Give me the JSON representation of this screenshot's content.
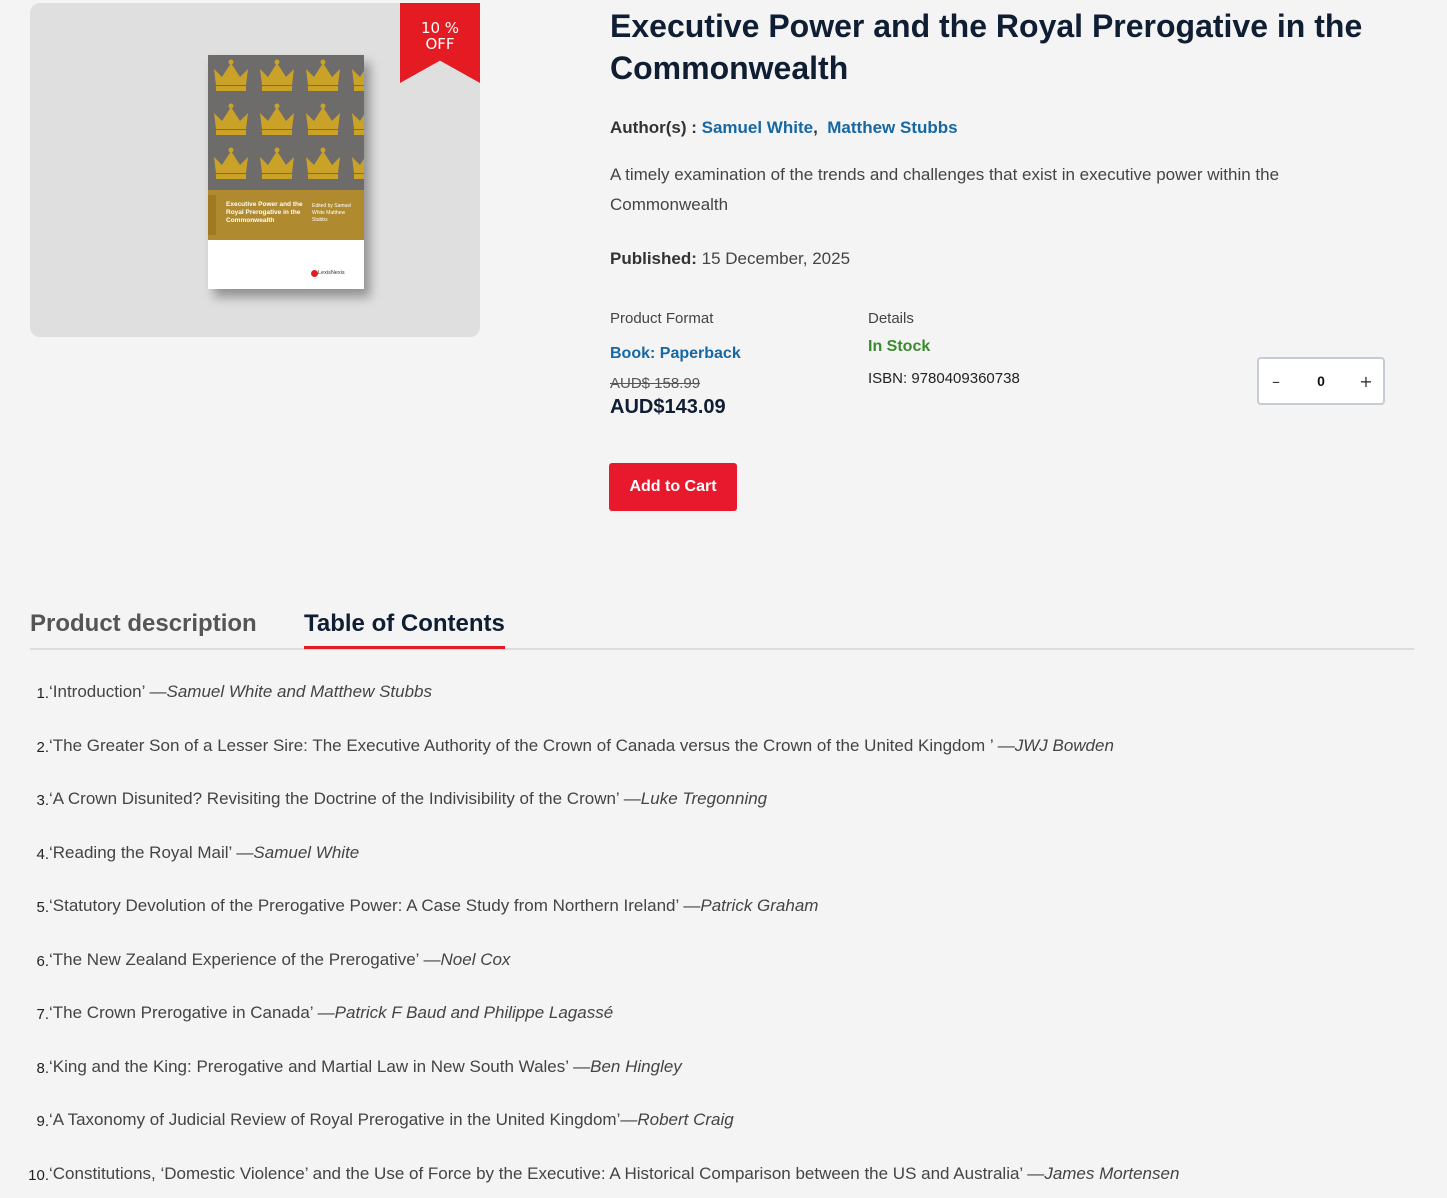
{
  "badge": {
    "line1": "10 %",
    "line2": "OFF"
  },
  "cover": {
    "title": "Executive Power and the Royal Prerogative in the Commonwealth",
    "editors": "Edited by Samuel White Matthew Stubbs",
    "publisher": "LexisNexis"
  },
  "product": {
    "title": "Executive Power and the Royal Prerogative in the Commonwealth",
    "authors_label": "Author(s) :",
    "authors": [
      "Samuel White",
      "Matthew Stubbs"
    ],
    "author_separator": ",",
    "summary": "A timely examination of the trends and challenges that exist in executive power within the Commonwealth",
    "published_label": "Published:",
    "published_date": "15 December, 2025",
    "format_label": "Product Format",
    "format_value": "Book: Paperback",
    "old_price": "AUD$ 158.99",
    "price": "AUD$143.09",
    "details_label": "Details",
    "stock": "In Stock",
    "isbn": "ISBN: 9780409360738",
    "quantity": "0",
    "qty_minus": "–",
    "qty_plus": "+",
    "add_to_cart": "Add to Cart"
  },
  "tabs": [
    "Product description",
    "Table of Contents"
  ],
  "toc": [
    {
      "num": "1.",
      "title": "‘Introduction’ — ",
      "author": "Samuel White and Matthew Stubbs"
    },
    {
      "num": "2.",
      "title": "‘The Greater Son of a Lesser Sire: The Executive Authority of the Crown of Canada versus the Crown of the United Kingdom ’ — ",
      "author": "JWJ Bowden"
    },
    {
      "num": "3.",
      "title": "‘A Crown Disunited? Revisiting the Doctrine of the Indivisibility of the Crown’ — ",
      "author": "Luke Tregonning"
    },
    {
      "num": "4.",
      "title": "‘Reading the Royal Mail’ — ",
      "author": "Samuel White"
    },
    {
      "num": "5.",
      "title": "‘Statutory Devolution of the Prerogative Power: A Case Study from Northern Ireland’ — ",
      "author": "Patrick Graham"
    },
    {
      "num": "6.",
      "title": "‘The New Zealand Experience of the Prerogative’ — ",
      "author": "Noel Cox"
    },
    {
      "num": "7.",
      "title": "‘The Crown Prerogative in Canada’ — ",
      "author": "Patrick F Baud and Philippe Lagassé"
    },
    {
      "num": "8.",
      "title": "‘King and the King: Prerogative and Martial Law in New South Wales’ — ",
      "author": "Ben Hingley"
    },
    {
      "num": "9.",
      "title": "‘A Taxonomy of Judicial Review of Royal Prerogative in the United Kingdom’— ",
      "author": "Robert Craig"
    },
    {
      "num": "10.",
      "title": "‘Constitutions, ‘Domestic Violence’ and the Use of Force by the Executive: A Historical Comparison between the US and Australia’ — ",
      "author": "James Mortensen"
    }
  ],
  "colors": {
    "accent": "#e41b23",
    "link": "#1767a3",
    "stock": "#3a8a2e",
    "heading": "#0f1e33"
  }
}
